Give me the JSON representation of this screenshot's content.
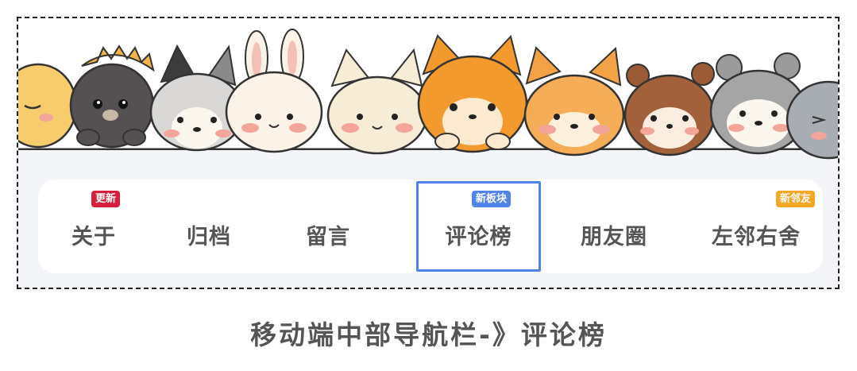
{
  "nav": {
    "items": [
      {
        "label": "关于",
        "badge": "更新",
        "badge_color": "#d81e3a"
      },
      {
        "label": "归档"
      },
      {
        "label": "留言"
      },
      {
        "label": "评论榜",
        "badge": "新板块",
        "badge_color": "#4f84ea",
        "selected": true
      },
      {
        "label": "朋友圈"
      },
      {
        "label": "左邻右舍",
        "badge": "新邻友",
        "badge_color": "#f5a623"
      }
    ]
  },
  "caption": "移动端中部导航栏-》评论榜",
  "colors": {
    "highlight": "#4f84ea",
    "frame_border": "#222222",
    "nav_bg": "#ffffff",
    "page_bg": "#f4f5f8"
  },
  "banner": {
    "animals": [
      "chick",
      "black-bear",
      "husky",
      "bunny",
      "cat",
      "orange-cat",
      "fox",
      "chipmunk",
      "raccoon",
      "grey-cat"
    ]
  }
}
